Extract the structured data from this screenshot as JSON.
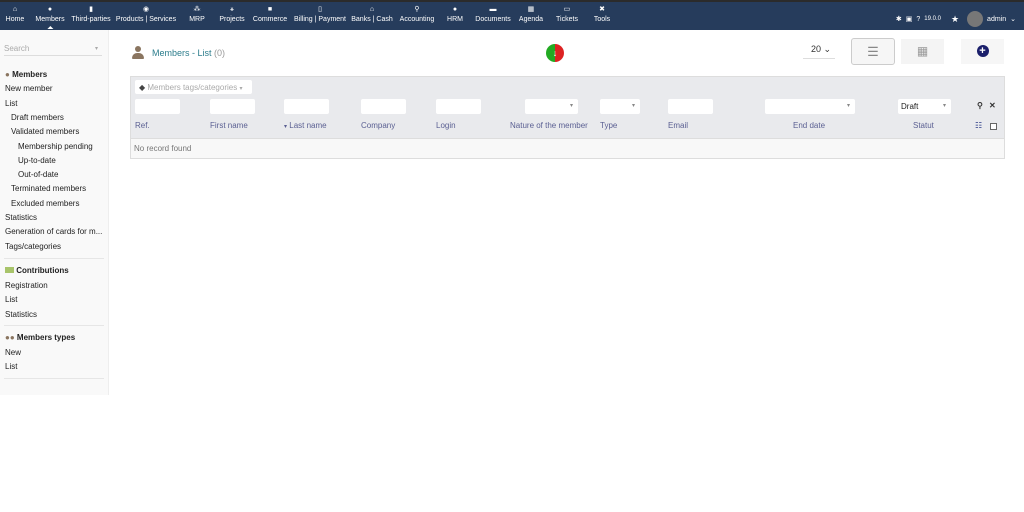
{
  "topmenu": [
    {
      "label": "Home",
      "icon": "home-icon",
      "glyph": "⌂"
    },
    {
      "label": "Members",
      "icon": "user-icon",
      "glyph": "●"
    },
    {
      "label": "Third-parties",
      "icon": "building-icon",
      "glyph": "▮"
    },
    {
      "label": "Products | Services",
      "icon": "cube-icon",
      "glyph": "◉"
    },
    {
      "label": "MRP",
      "icon": "cubes-icon",
      "glyph": "⁂"
    },
    {
      "label": "Projects",
      "icon": "project-icon",
      "glyph": "⚹"
    },
    {
      "label": "Commerce",
      "icon": "briefcase-icon",
      "glyph": "■"
    },
    {
      "label": "Billing | Payment",
      "icon": "invoice-icon",
      "glyph": "▯"
    },
    {
      "label": "Banks | Cash",
      "icon": "bank-icon",
      "glyph": "⌂"
    },
    {
      "label": "Accounting",
      "icon": "search-dollar-icon",
      "glyph": "⚲"
    },
    {
      "label": "HRM",
      "icon": "user-tie-icon",
      "glyph": "●"
    },
    {
      "label": "Documents",
      "icon": "folder-icon",
      "glyph": "▬"
    },
    {
      "label": "Agenda",
      "icon": "calendar-icon",
      "glyph": "▦"
    },
    {
      "label": "Tickets",
      "icon": "ticket-icon",
      "glyph": "▭"
    },
    {
      "label": "Tools",
      "icon": "tools-icon",
      "glyph": "✖"
    }
  ],
  "right": {
    "version": "19.0.0",
    "user": "admin"
  },
  "sidebar": {
    "search_placeholder": "Search",
    "members_title": "Members",
    "members": [
      "New member",
      "List",
      "Draft members",
      "Validated members",
      "Membership pending",
      "Up-to-date",
      "Out-of-date",
      "Terminated members",
      "Excluded members",
      "Statistics",
      "Generation of cards for m...",
      "Tags/categories"
    ],
    "contrib_title": "Contributions",
    "contrib": [
      "Registration",
      "List",
      "Statistics"
    ],
    "types_title": "Members types",
    "types": [
      "New",
      "List"
    ]
  },
  "page": {
    "title": "Members - List",
    "count": "(0)",
    "limit": "20"
  },
  "table": {
    "tags_placeholder": "Members tags/categories",
    "status_filter": "Draft",
    "columns": [
      "Ref.",
      "First name",
      "Last name",
      "Company",
      "Login",
      "Nature of the member",
      "Type",
      "Email",
      "End date",
      "Statut"
    ],
    "empty": "No record found"
  },
  "colors": {
    "topbar": "#263c5c",
    "link": "#2c7d8c",
    "header": "#5a5f92"
  }
}
